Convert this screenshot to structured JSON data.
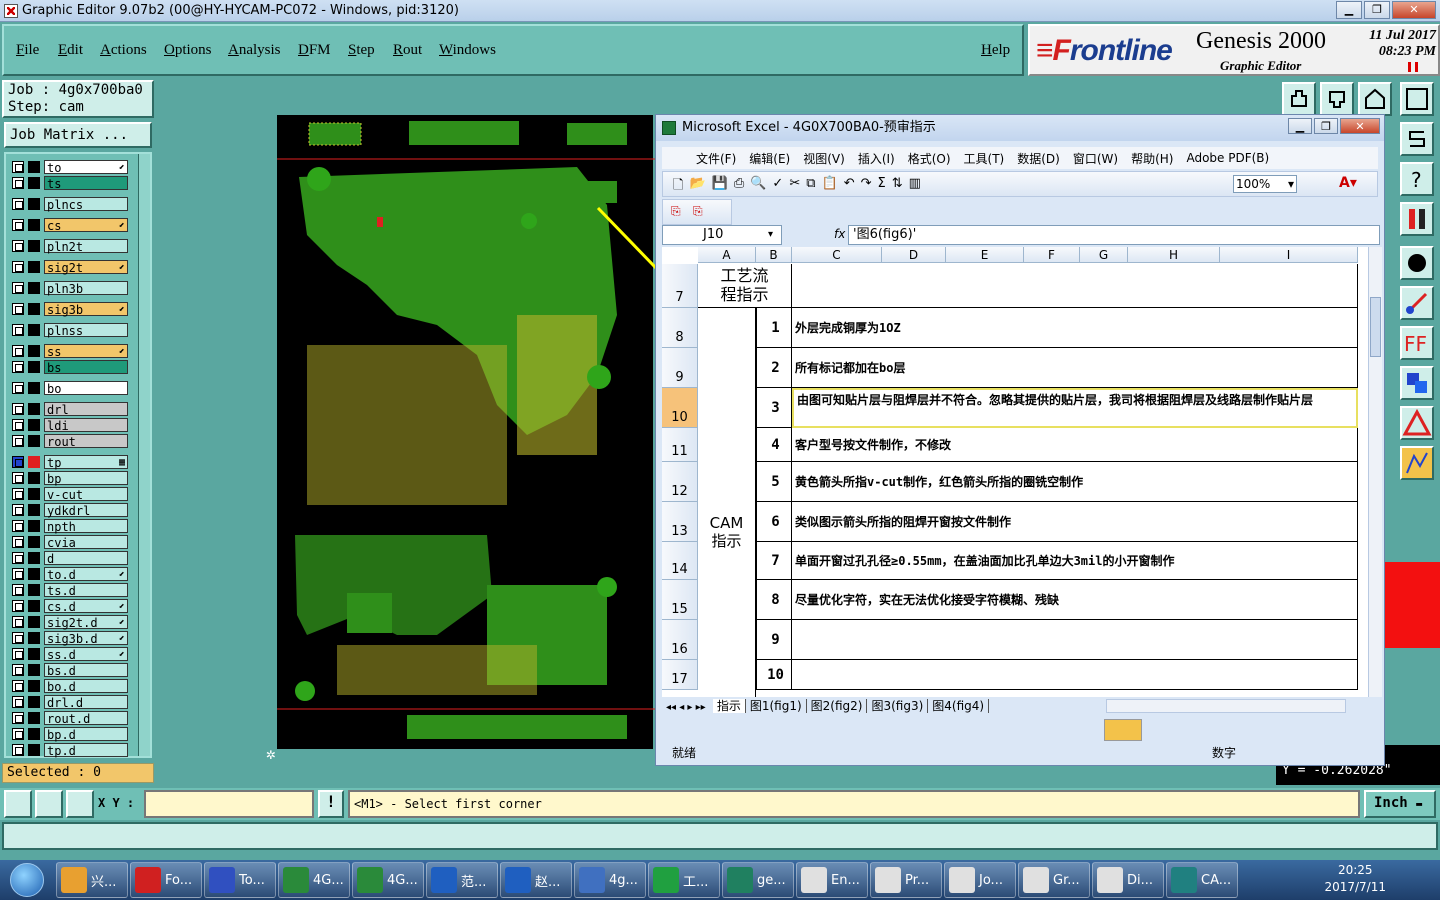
{
  "window": {
    "title": "Graphic Editor 9.07b2 (00@HY-HYCAM-PC072 - Windows, pid:3120)"
  },
  "menu": [
    "File",
    "Edit",
    "Actions",
    "Options",
    "Analysis",
    "DFM",
    "Step",
    "Rout",
    "Windows"
  ],
  "help": "Help",
  "logo": {
    "brand_a": "≡F",
    "brand_b": "rontline",
    "product": "Genesis 2000",
    "sub": "Graphic Editor",
    "date": "11 Jul 2017",
    "time": "08:23 PM"
  },
  "job": {
    "job": "Job : 4g0x700ba0",
    "step": "Step: cam",
    "matrix": "Job Matrix ..."
  },
  "layers": [
    {
      "name": "to",
      "color": "#ffffff",
      "flag": "⬋"
    },
    {
      "name": "ts",
      "color": "#1f9a7a",
      "flag": ""
    },
    {
      "name": "plncs",
      "color": "#b9e8e2",
      "flag": ""
    },
    {
      "name": "cs",
      "color": "#f2c66a",
      "flag": "⬋"
    },
    {
      "name": "pln2t",
      "color": "#b9e8e2",
      "flag": ""
    },
    {
      "name": "sig2t",
      "color": "#f2c66a",
      "flag": "⬋"
    },
    {
      "name": "pln3b",
      "color": "#b9e8e2",
      "flag": ""
    },
    {
      "name": "sig3b",
      "color": "#f2c66a",
      "flag": "⬋"
    },
    {
      "name": "plnss",
      "color": "#b9e8e2",
      "flag": ""
    },
    {
      "name": "ss",
      "color": "#f2c66a",
      "flag": "⬋"
    },
    {
      "name": "bs",
      "color": "#1f9a7a",
      "flag": ""
    },
    {
      "name": "bo",
      "color": "#ffffff",
      "flag": ""
    },
    {
      "name": "drl",
      "color": "#c8c8c8",
      "flag": ""
    },
    {
      "name": "ldi",
      "color": "#c8c8c8",
      "flag": ""
    },
    {
      "name": "rout",
      "color": "#c8c8c8",
      "flag": ""
    },
    {
      "name": "tp",
      "color": "#b9e8e2",
      "flag": "▦"
    },
    {
      "name": "bp",
      "color": "#b9e8e2",
      "flag": ""
    },
    {
      "name": "v-cut",
      "color": "#b9e8e2",
      "flag": ""
    },
    {
      "name": "ydkdrl",
      "color": "#b9e8e2",
      "flag": ""
    },
    {
      "name": "npth",
      "color": "#b9e8e2",
      "flag": ""
    },
    {
      "name": "cvia",
      "color": "#b9e8e2",
      "flag": ""
    },
    {
      "name": "d",
      "color": "#b9e8e2",
      "flag": ""
    },
    {
      "name": "to.d",
      "color": "#b9e8e2",
      "flag": "⬋"
    },
    {
      "name": "ts.d",
      "color": "#b9e8e2",
      "flag": ""
    },
    {
      "name": "cs.d",
      "color": "#b9e8e2",
      "flag": "⬋"
    },
    {
      "name": "sig2t.d",
      "color": "#b9e8e2",
      "flag": "⬋"
    },
    {
      "name": "sig3b.d",
      "color": "#b9e8e2",
      "flag": "⬋"
    },
    {
      "name": "ss.d",
      "color": "#b9e8e2",
      "flag": "⬋"
    },
    {
      "name": "bs.d",
      "color": "#b9e8e2",
      "flag": ""
    },
    {
      "name": "bo.d",
      "color": "#b9e8e2",
      "flag": ""
    },
    {
      "name": "drl.d",
      "color": "#b9e8e2",
      "flag": ""
    },
    {
      "name": "rout.d",
      "color": "#b9e8e2",
      "flag": ""
    },
    {
      "name": "bp.d",
      "color": "#b9e8e2",
      "flag": ""
    },
    {
      "name": "tp.d",
      "color": "#b9e8e2",
      "flag": ""
    }
  ],
  "selected": "Selected : 0",
  "command": {
    "xy_label": "X Y :",
    "xy_value": "",
    "alert": "!",
    "message": "<M1> - Select first corner",
    "units": "Inch"
  },
  "coord": "Y = -0.262028\"",
  "excel": {
    "title": "Microsoft Excel - 4G0X700BA0-预审指示",
    "menu": [
      "文件(F)",
      "编辑(E)",
      "视图(V)",
      "插入(I)",
      "格式(O)",
      "工具(T)",
      "数据(D)",
      "窗口(W)",
      "帮助(H)",
      "Adobe PDF(B)"
    ],
    "zoom": "100%",
    "namebox": "J10",
    "fx": "fx",
    "formula": "'图6(fig6)'",
    "columns": [
      "A",
      "B",
      "C",
      "D",
      "E",
      "F",
      "G",
      "H",
      "I"
    ],
    "section1": "工艺流程指示",
    "section2": "CAM指示",
    "rows": [
      {
        "row": "7",
        "num": "",
        "text": ""
      },
      {
        "row": "8",
        "num": "1",
        "text": "外层完成铜厚为1OZ"
      },
      {
        "row": "9",
        "num": "2",
        "text": "所有标记都加在bo层"
      },
      {
        "row": "10",
        "num": "3",
        "text": "由图可知贴片层与阻焊层并不符合。忽略其提供的贴片层，我司将根据阻焊层及线路层制作贴片层"
      },
      {
        "row": "11",
        "num": "4",
        "text": "客户型号按文件制作，不修改"
      },
      {
        "row": "12",
        "num": "5",
        "text": "黄色箭头所指v-cut制作，红色箭头所指的圈铣空制作"
      },
      {
        "row": "13",
        "num": "6",
        "text": "类似图示箭头所指的阻焊开窗按文件制作"
      },
      {
        "row": "14",
        "num": "7",
        "text": "单面开窗过孔孔径≥0.55mm，在盖油面加比孔单边大3mil的小开窗制作"
      },
      {
        "row": "15",
        "num": "8",
        "text": "尽量优化字符，实在无法优化接受字符模糊、残缺"
      },
      {
        "row": "16",
        "num": "9",
        "text": ""
      },
      {
        "row": "17",
        "num": "10",
        "text": ""
      }
    ],
    "tabs": [
      "指示",
      "图1(fig1)",
      "图2(fig2)",
      "图3(fig3)",
      "图4(fig4)"
    ],
    "status_left": "就绪",
    "status_right": "数字"
  },
  "taskbar": {
    "items": [
      {
        "label": "兴...",
        "color": "#e8a030"
      },
      {
        "label": "Fo...",
        "color": "#d02020"
      },
      {
        "label": "To...",
        "color": "#3050c0"
      },
      {
        "label": "4G...",
        "color": "#2a8a3a"
      },
      {
        "label": "4G...",
        "color": "#2a8a3a"
      },
      {
        "label": "范...",
        "color": "#1f5fc0"
      },
      {
        "label": "赵...",
        "color": "#1f5fc0"
      },
      {
        "label": "4g...",
        "color": "#4070c0"
      },
      {
        "label": "工...",
        "color": "#20a040"
      },
      {
        "label": "ge...",
        "color": "#208060"
      },
      {
        "label": "En...",
        "color": "#e0e0e0"
      },
      {
        "label": "Pr...",
        "color": "#e0e0e0"
      },
      {
        "label": "Jo...",
        "color": "#e0e0e0"
      },
      {
        "label": "Gr...",
        "color": "#e0e0e0"
      },
      {
        "label": "Di...",
        "color": "#e0e0e0"
      },
      {
        "label": "CA...",
        "color": "#208080"
      }
    ],
    "time": "20:25",
    "date": "2017/7/11"
  }
}
